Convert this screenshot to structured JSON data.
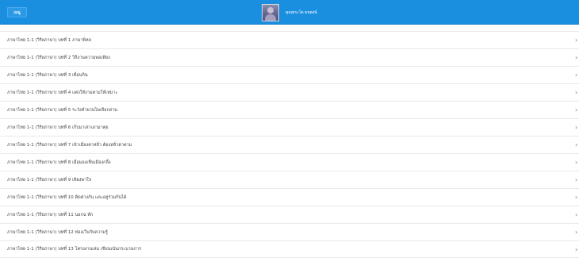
{
  "header": {
    "menu_label": "เมนู",
    "user_name": "คุณพระโต ธนพงษ์"
  },
  "icons": {
    "avatar": "user-avatar",
    "chevron": "chevron-right-icon"
  },
  "colors": {
    "header_bg": "#1a8fe0",
    "row_text": "#444444",
    "divider": "#e9e9e9"
  },
  "list": {
    "items": [
      {
        "label": "ภาษาไทย 1-1 (วิริยภาษา) บทที่ 1 ภาษาพิหล"
      },
      {
        "label": "ภาษาไทย 1-1 (วิริยภาษา) บทที่ 2 วิถีงานความพอเพียง"
      },
      {
        "label": "ภาษาไทย 1-1 (วิริยภาษา) บทที่ 3 เพื่อนกิน"
      },
      {
        "label": "ภาษาไทย 1-1 (วิริยภาษา) บทที่ 4 แต่งให้งามตามให้เหมาะ"
      },
      {
        "label": "ภาษาไทย 1-1 (วิริยภาษา) บทที่ 5 ระวังคำผวนไพเลือกอ่าน"
      },
      {
        "label": "ภาษาไทย 1-1 (วิริยภาษา) บทที่ 6 เก็บมาเล่าเอามาคุย"
      },
      {
        "label": "ภาษาไทย 1-1 (วิริยภาษา) บทที่ 7 เข้าเมืองตาหลิ่ว ต้องหลิ่วตาตาม"
      },
      {
        "label": "ภาษาไทย 1-1 (วิริยภาษา) บทที่ 8 เมื่อมองเห็นเมืองกลิ้ง"
      },
      {
        "label": "ภาษาไทย 1-1 (วิริยภาษา) บทที่ 9 เพียงพาใจ"
      },
      {
        "label": "ภาษาไทย 1-1 (วิริยภาษา) บทที่ 10 คิดต่างกัน และอยู่ร่วมกันได้"
      },
      {
        "label": "ภาษาไทย 1-1 (วิริยภาษา) บทที่ 11 นอกฉ ทัก"
      },
      {
        "label": "ภาษาไทย 1-1 (วิริยภาษา) บทที่ 12 ท่องเว็บกับความรู้"
      },
      {
        "label": "ภาษาไทย 1-1 (วิริยภาษา) บทที่ 13 โครงงานเล่ม เขียนเน้นกระบวนการ"
      }
    ]
  }
}
